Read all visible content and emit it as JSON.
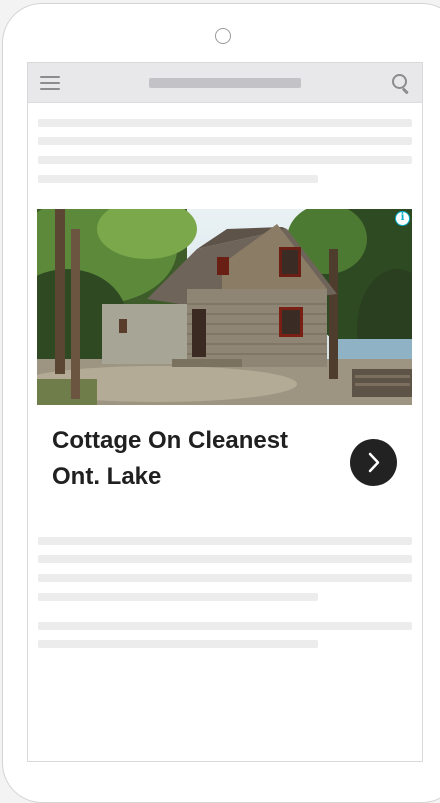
{
  "ad": {
    "title": "Cottage On Cleanest Ont. Lake",
    "info_symbol": "i"
  },
  "icons": {
    "menu": "hamburger-menu-icon",
    "search": "search-icon",
    "info": "info-icon",
    "next": "chevron-right-icon"
  },
  "colors": {
    "placeholder_line": "#ececec",
    "topbar": "#e8e8ea",
    "ad_button": "#222222",
    "info_accent": "#00aecd"
  }
}
